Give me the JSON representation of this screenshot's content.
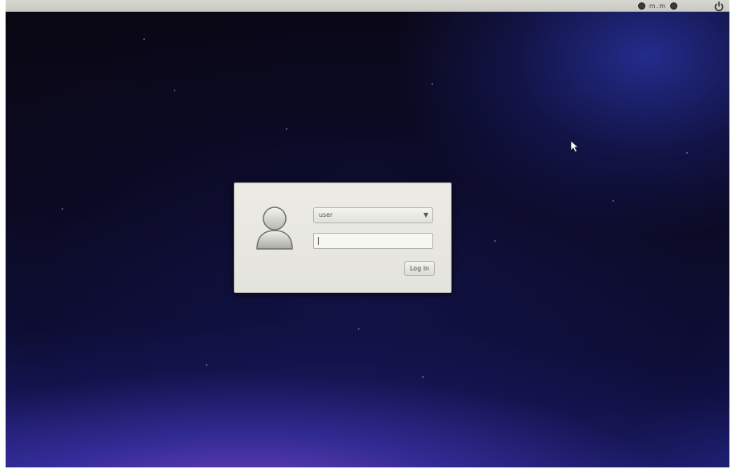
{
  "topbar": {
    "language": "m.m",
    "icons": [
      "accessibility-icon",
      "keyboard-layout-icon",
      "volume-icon",
      "power-icon"
    ]
  },
  "login": {
    "user_select": {
      "selected": "user"
    },
    "password": {
      "value": "",
      "placeholder": ""
    },
    "login_button_label": "Log In"
  }
}
